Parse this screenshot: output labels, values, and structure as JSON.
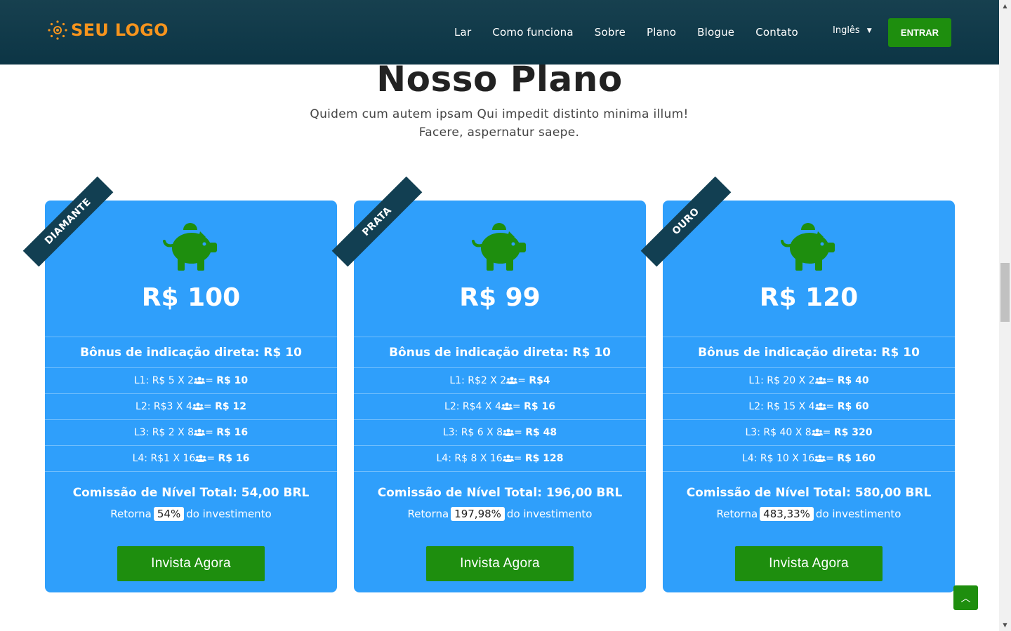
{
  "header": {
    "logo_text": "SEU LOGO",
    "nav": [
      "Lar",
      "Como funciona",
      "Sobre",
      "Plano",
      "Blogue",
      "Contato"
    ],
    "language": "Inglês",
    "login_label": "ENTRAR"
  },
  "section": {
    "title": "Nosso Plano",
    "subtitle": "Quidem cum autem ipsam Qui impedit distinto minima illum! Facere, aspernatur saepe."
  },
  "colors": {
    "header_bg": "#0c3545",
    "card_bg": "#2f9ffb",
    "accent_green": "#1e8e0e",
    "ribbon_bg": "#123f52",
    "logo_orange": "#f7941d"
  },
  "icons": [
    "piggy-bank-icon",
    "users-icon",
    "chevron-down-icon",
    "chevron-up-icon"
  ],
  "plans": [
    {
      "ribbon": "DIAMANTE",
      "price": "R$ 100",
      "bonus": "Bônus de indicação direta: R$ 10",
      "levels": [
        {
          "prefix": "L1: R$ 5 X 2",
          "result": "R$ 10"
        },
        {
          "prefix": "L2: R$3 X 4",
          "result": "R$ 12"
        },
        {
          "prefix": "L3: R$ 2 X 8",
          "result": "R$ 16"
        },
        {
          "prefix": "L4: R$1 X 16",
          "result": "R$ 16"
        }
      ],
      "commission": "Comissão de Nível Total: 54,00 BRL",
      "returns_label": "Retorna",
      "returns_pct": "54%",
      "returns_suffix": "do investimento",
      "button": "Invista Agora"
    },
    {
      "ribbon": "PRATA",
      "price": "R$ 99",
      "bonus": "Bônus de indicação direta: R$ 10",
      "levels": [
        {
          "prefix": "L1: R$2 X 2",
          "result": "R$4"
        },
        {
          "prefix": "L2: R$4 X 4",
          "result": "R$ 16"
        },
        {
          "prefix": "L3: R$ 6 X 8",
          "result": "R$ 48"
        },
        {
          "prefix": "L4: R$ 8 X 16",
          "result": "R$ 128"
        }
      ],
      "commission": "Comissão de Nível Total: 196,00 BRL",
      "returns_label": "Retorna",
      "returns_pct": "197,98%",
      "returns_suffix": "do investimento",
      "button": "Invista Agora"
    },
    {
      "ribbon": "OURO",
      "price": "R$ 120",
      "bonus": "Bônus de indicação direta: R$ 10",
      "levels": [
        {
          "prefix": "L1: R$ 20 X 2",
          "result": "R$ 40"
        },
        {
          "prefix": "L2: R$ 15 X 4",
          "result": "R$ 60"
        },
        {
          "prefix": "L3: R$ 40 X 8",
          "result": "R$ 320"
        },
        {
          "prefix": "L4: R$ 10 X 16",
          "result": "R$ 160"
        }
      ],
      "commission": "Comissão de Nível Total: 580,00 BRL",
      "returns_label": "Retorna",
      "returns_pct": "483,33%",
      "returns_suffix": "do investimento",
      "button": "Invista Agora"
    }
  ]
}
